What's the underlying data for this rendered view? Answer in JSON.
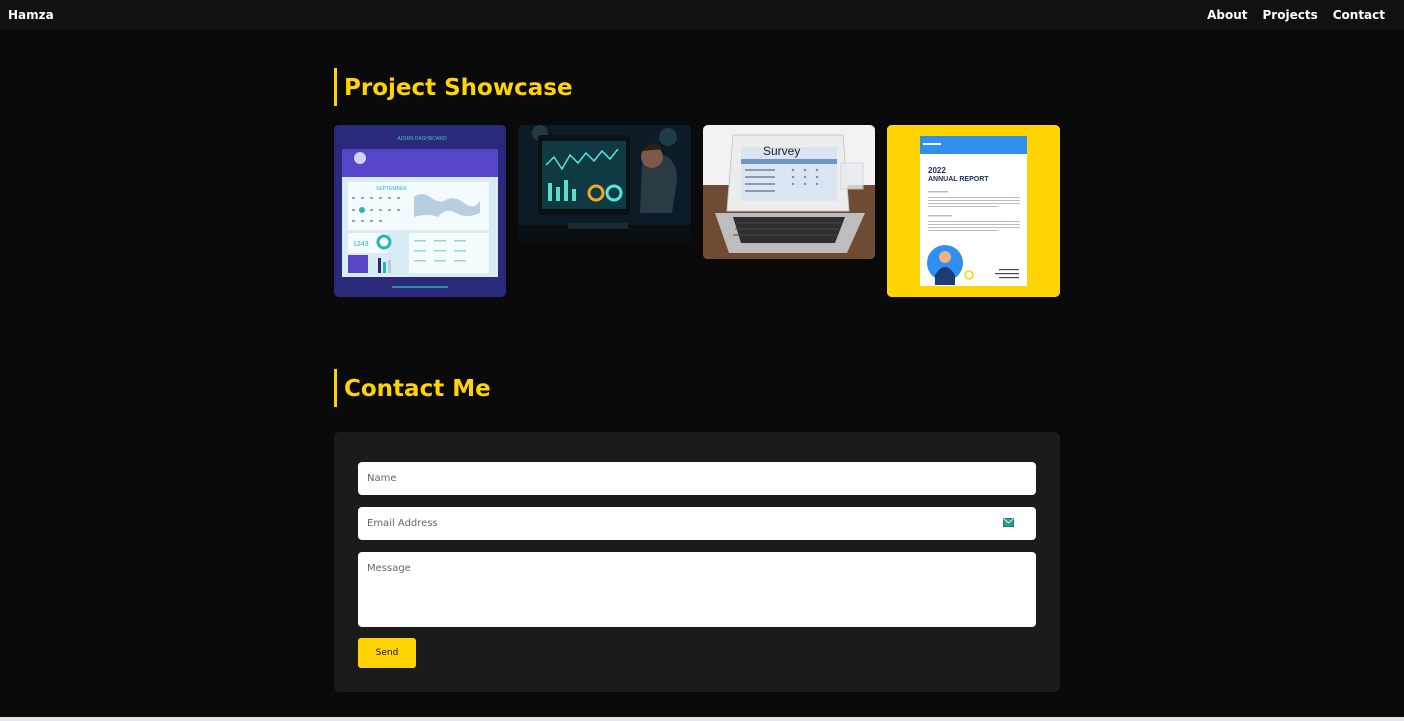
{
  "header": {
    "brand": "Hamza",
    "nav": [
      "About",
      "Projects",
      "Contact"
    ]
  },
  "projects": {
    "title": "Project Showcase",
    "cards": [
      {
        "image": "admin-dashboard-preview",
        "text_month": "SEPTEMBER",
        "text_value": "1243",
        "text_header": "ADMIN DASHBOARD"
      },
      {
        "image": "data-analyst-at-monitor"
      },
      {
        "image": "survey-laptop",
        "text_survey": "Survey"
      },
      {
        "image": "annual-report-cover",
        "text_year": "2022",
        "text_report": "ANNUAL REPORT"
      }
    ]
  },
  "contact": {
    "title": "Contact Me",
    "name_placeholder": "Name",
    "email_placeholder": "Email Address",
    "message_placeholder": "Message",
    "send_label": "Send",
    "email_icon": "envelope-icon"
  },
  "colors": {
    "accent": "#ffd400",
    "background": "#0a0a0a",
    "topbar": "#111111",
    "panel": "#1b1b1b"
  }
}
